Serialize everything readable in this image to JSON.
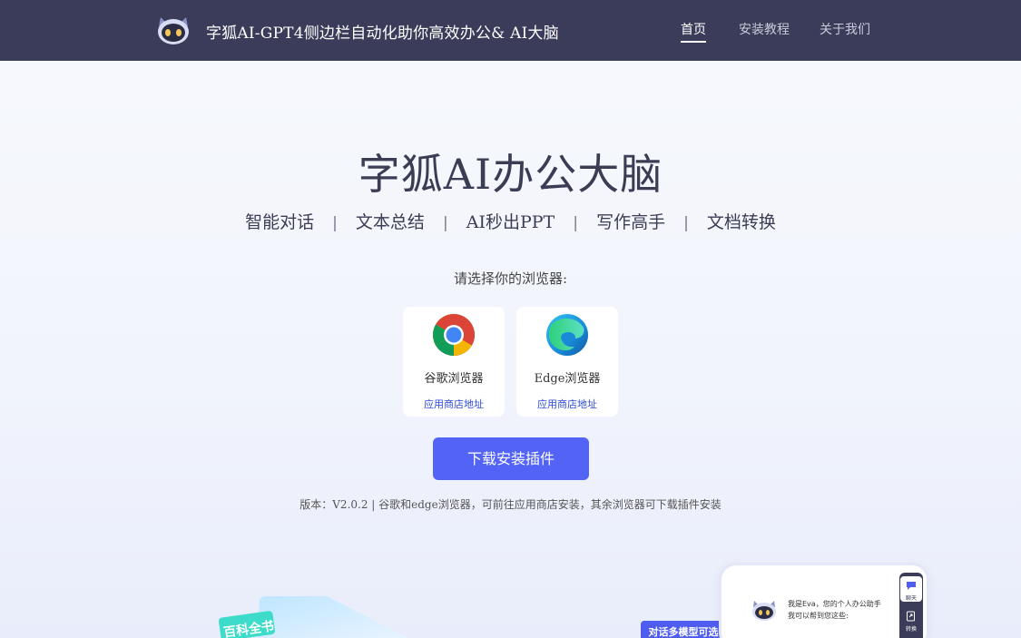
{
  "header": {
    "site_title": "字狐AI-GPT4侧边栏自动化助你高效办公& AI大脑",
    "nav": [
      {
        "label": "首页",
        "active": true
      },
      {
        "label": "安装教程",
        "active": false
      },
      {
        "label": "关于我们",
        "active": false
      }
    ],
    "logo_icon": "fox-robot-logo-icon"
  },
  "hero": {
    "title": "字狐AI办公大脑",
    "features": [
      "智能对话",
      "文本总结",
      "AI秒出PPT",
      "写作高手",
      "文档转换"
    ],
    "separator": "|",
    "choose_browser": "请选择你的浏览器:"
  },
  "browsers": [
    {
      "name": "谷歌浏览器",
      "store_link": "应用商店地址",
      "icon": "chrome-icon"
    },
    {
      "name": "Edge浏览器",
      "store_link": "应用商店地址",
      "icon": "edge-icon"
    }
  ],
  "download_button": "下载安装插件",
  "version_note": "版本：V2.0.2 | 谷歌和edge浏览器，可前往应用商店安装，其余浏览器可下载插件安装",
  "preview": {
    "badge": "对话多模型可选",
    "left_badge": "百科全书",
    "greeting_line1": "我是Eva，您的个人办公助手",
    "greeting_line2": "我可以帮到您这些:",
    "side_buttons": [
      {
        "label": "聊天",
        "icon": "chat-icon",
        "active": true
      },
      {
        "label": "转换",
        "icon": "convert-icon",
        "active": false
      }
    ]
  },
  "colors": {
    "header_bg": "#3a3c59",
    "accent": "#5263f6",
    "link": "#2d4bd8"
  }
}
